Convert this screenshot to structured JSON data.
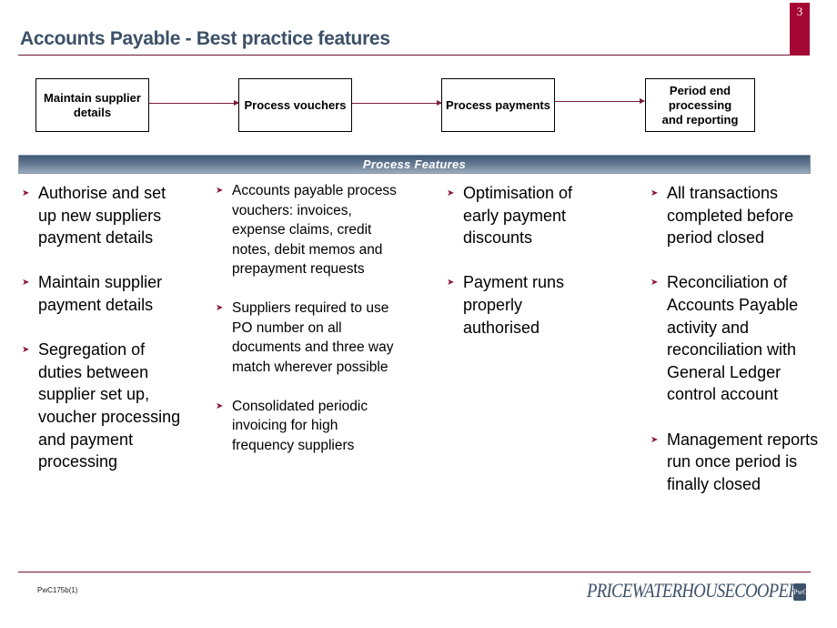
{
  "slide": {
    "page_number": "3",
    "title": "Accounts Payable - Best practice features"
  },
  "process_flow": {
    "steps": [
      {
        "label": "Maintain supplier details"
      },
      {
        "label": "Process vouchers"
      },
      {
        "label": "Process payments"
      },
      {
        "label": "Period end processing and reporting"
      }
    ]
  },
  "features_header": "Process Features",
  "columns": [
    {
      "items": [
        "Authorise and set up new suppliers payment details",
        "Maintain supplier payment details",
        "Segregation of duties between supplier set up, voucher processing and payment processing"
      ]
    },
    {
      "items": [
        "Accounts payable process vouchers: invoices, expense claims, credit notes, debit memos and prepayment requests",
        "Suppliers required to use PO number on all documents and three way match wherever possible",
        "Consolidated periodic invoicing for high frequency suppliers"
      ]
    },
    {
      "items": [
        "Optimisation of early payment discounts",
        "Payment runs properly authorised"
      ]
    },
    {
      "items": [
        "All transactions completed before period closed",
        "Reconciliation of Accounts Payable activity and reconciliation with General Ledger control account",
        "Management reports run once period is finally closed"
      ]
    }
  ],
  "bullet_icon": "arrowhead-bullet",
  "footer": {
    "code": "PwC175b(1)",
    "logo_text": "PRICEWATERHOUSECOOPERS",
    "logo_mark": "PwC"
  },
  "colors": {
    "accent": "#a50734",
    "title": "#3c5068",
    "rule": "#6e1437"
  }
}
